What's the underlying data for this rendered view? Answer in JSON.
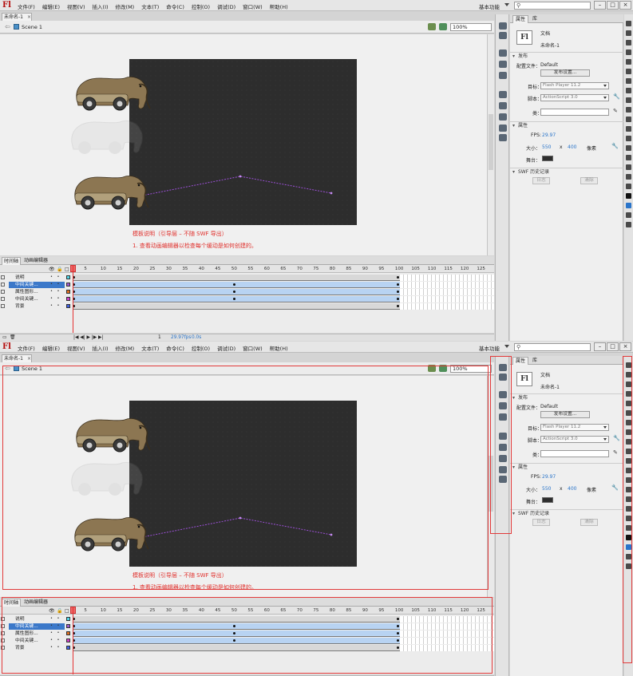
{
  "app": {
    "logo": "Fl",
    "menu_items": [
      "文件(F)",
      "编辑(E)",
      "视图(V)",
      "插入(I)",
      "修改(M)",
      "文本(T)",
      "命令(C)",
      "控制(O)",
      "调试(D)",
      "窗口(W)",
      "帮助(H)"
    ],
    "workspace": "基本功能",
    "window_buttons": [
      "–",
      "□",
      "×"
    ]
  },
  "document": {
    "tab_label": "未命名-1",
    "tab_close": "×",
    "scene_label": "Scene 1",
    "zoom": "100%"
  },
  "stage": {
    "note_title": "模板说明（引导层 – 不随 SWF 导出）",
    "note_line": "1. 查看动画编辑器以检查每个缓动是如何创建的。"
  },
  "timeline": {
    "tabs": [
      "时间轴",
      "动画编辑器"
    ],
    "ruler": [
      "1",
      "5",
      "10",
      "15",
      "20",
      "25",
      "30",
      "35",
      "40",
      "45",
      "50",
      "55",
      "60",
      "65",
      "70",
      "75",
      "80",
      "85",
      "90",
      "95",
      "100",
      "105",
      "110",
      "115",
      "120",
      "125"
    ],
    "layers": [
      {
        "name": "说明",
        "color": "#50d8e8",
        "type": "static",
        "selected": false
      },
      {
        "name": "中间关键...",
        "color": "#9b59d0",
        "type": "tween",
        "selected": true
      },
      {
        "name": "属性图形...",
        "color": "#e07020",
        "type": "tween",
        "selected": false
      },
      {
        "name": "中间关键...",
        "color": "#d040c8",
        "type": "tween",
        "selected": false
      },
      {
        "name": "背景",
        "color": "#4060e0",
        "type": "static",
        "selected": false
      }
    ],
    "footer_frame": "1",
    "footer_fps": "29.97fps",
    "footer_time": "0.0s"
  },
  "properties": {
    "tabs": [
      "属性",
      "库"
    ],
    "doc_icon": "Fl",
    "doc_type": "文档",
    "doc_name": "未命名-1",
    "publish_section": "发布",
    "profile_label": "配置文件：",
    "profile_value": "Default",
    "publish_settings_button": "发布设置...",
    "target_label": "目标：",
    "target_value": "Flash Player 11.2",
    "script_label": "脚本：",
    "script_value": "ActionScript 3.0",
    "class_label": "类：",
    "props_section": "属性",
    "fps_label": "FPS:",
    "fps_value": "29.97",
    "size_label": "大小：",
    "width": "550",
    "times": "x",
    "height": "400",
    "unit": "像素",
    "stage_label": "舞台：",
    "stage_color": "#2d2d2d",
    "history_section": "SWF 历史记录",
    "log_button": "日志",
    "clear_button": "清除"
  },
  "accent": {
    "highlight": "#e23a3a",
    "note_red": "#e0302c",
    "selection": "#3b78c9",
    "tween_fill": "#b8d3f2",
    "motion_path": "#9b4fd6"
  }
}
